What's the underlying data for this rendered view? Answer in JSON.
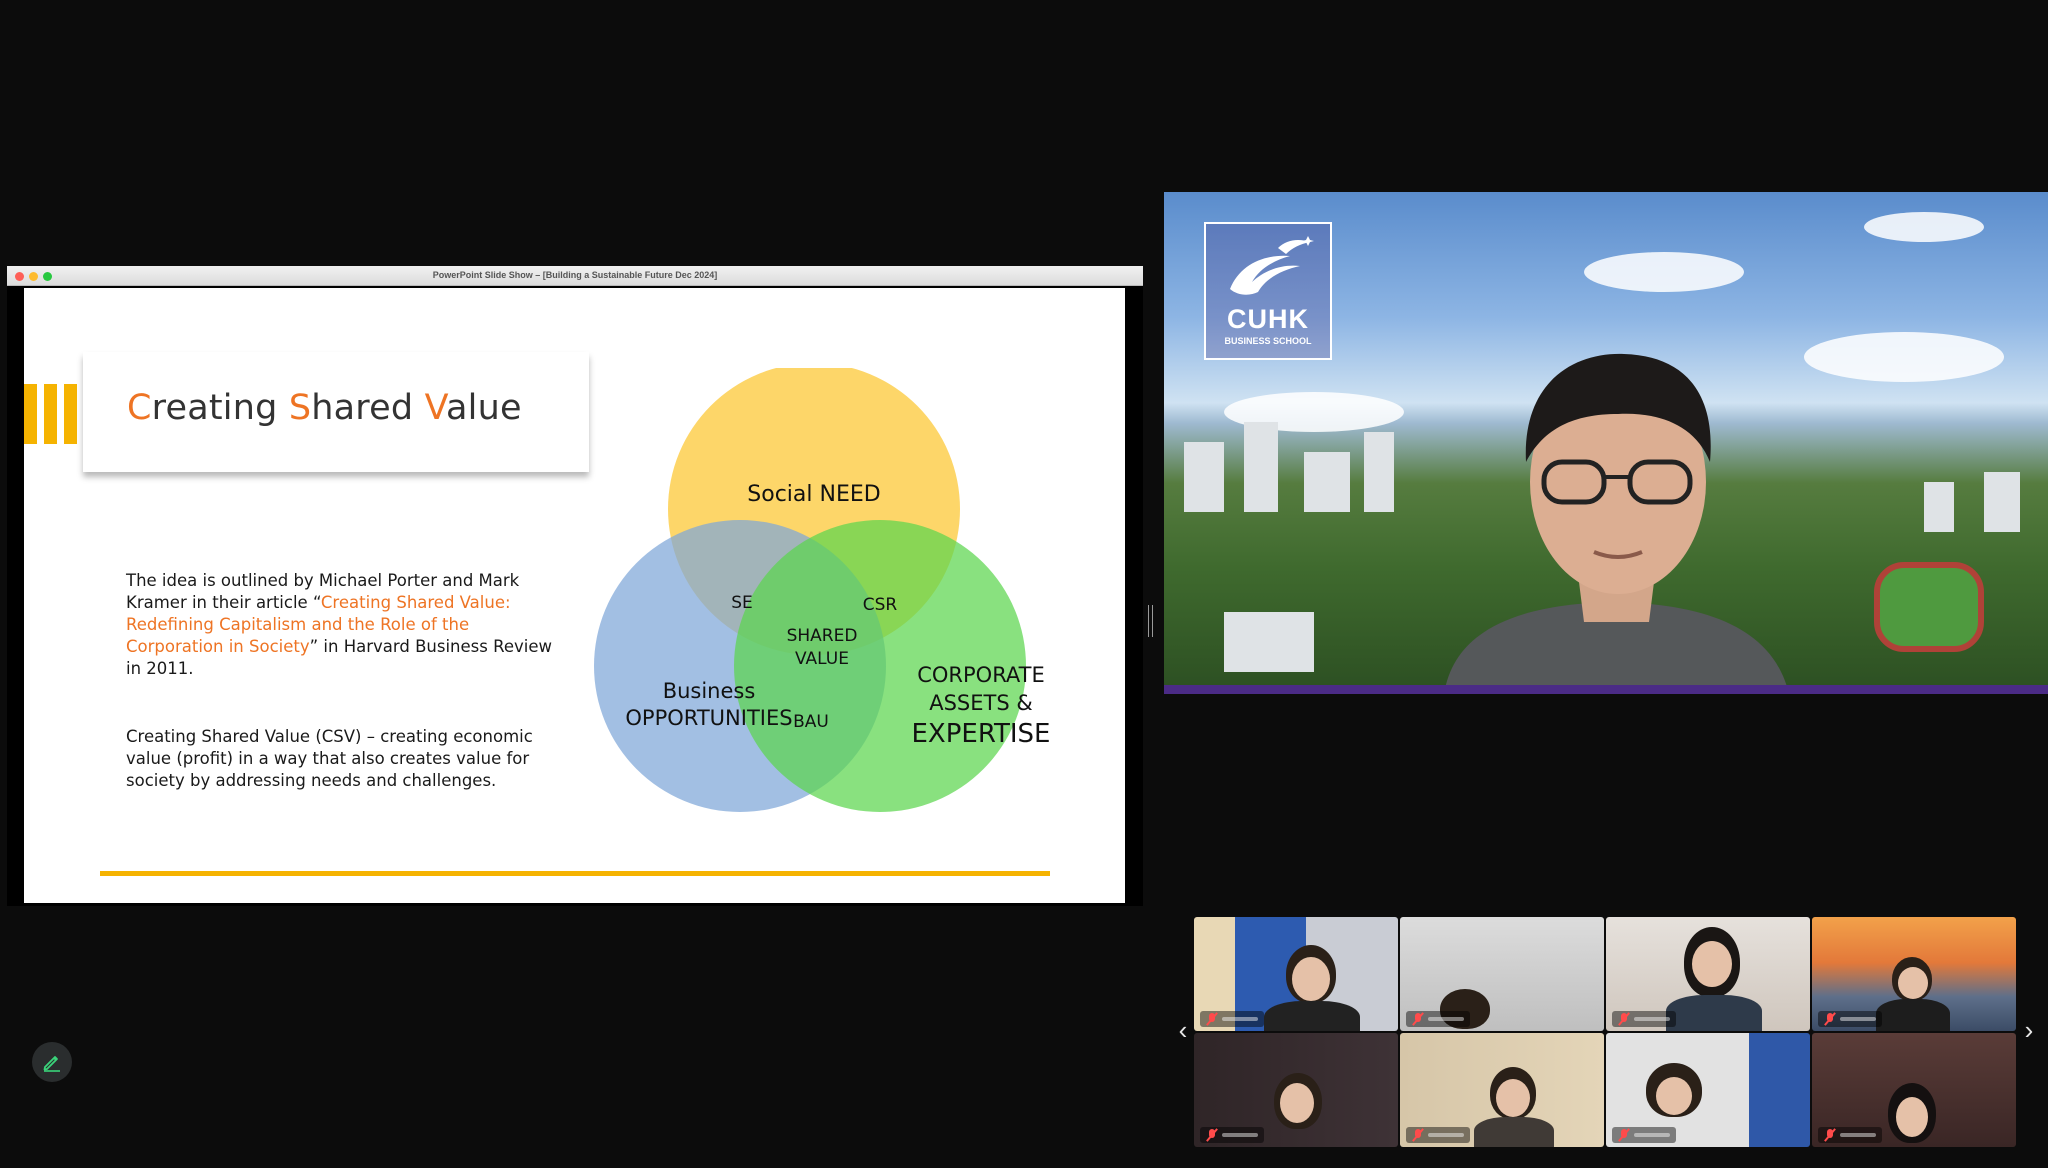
{
  "window": {
    "title": "PowerPoint Slide Show – [Building a Sustainable Future Dec 2024]"
  },
  "slide": {
    "title_parts": [
      "C",
      "reating ",
      "S",
      "hared ",
      "V",
      "alue"
    ],
    "para1": {
      "text_before": "The idea is outlined by Michael Porter and Mark Kramer in their article “",
      "highlight": "Creating Shared Value: Redefining Capitalism and the Role of the Corporation in Society",
      "text_after": "” in Harvard Business Review in 2011."
    },
    "para2": "Creating Shared Value (CSV) – creating economic value (profit) in a way that also creates value for society by addressing needs and challenges.",
    "venn": {
      "top": "Social NEED",
      "left_line1": "Business",
      "left_line2": "OPPORTUNITIES",
      "right_line1": "CORPORATE",
      "right_line2": "ASSETS &",
      "right_line3": "EXPERTISE",
      "overlap_top_left": "SE",
      "overlap_top_right": "CSR",
      "overlap_bottom": "BAU",
      "center_line1": "SHARED",
      "center_line2": "VALUE"
    }
  },
  "speaker": {
    "logo_name": "CUHK",
    "logo_sub": "BUSINESS SCHOOL"
  },
  "colors": {
    "accent_orange": "#ee7424",
    "stripe_yellow": "#f5b301",
    "circle_yellow": "#fccc44",
    "circle_blue": "#7ea6d8",
    "circle_green": "#5cd64d",
    "brand_purple": "#4b2b86"
  },
  "icons": {
    "prev": "chevron-left-icon",
    "next": "chevron-right-icon",
    "annotate": "pencil-icon",
    "muted": "mic-off-icon"
  }
}
